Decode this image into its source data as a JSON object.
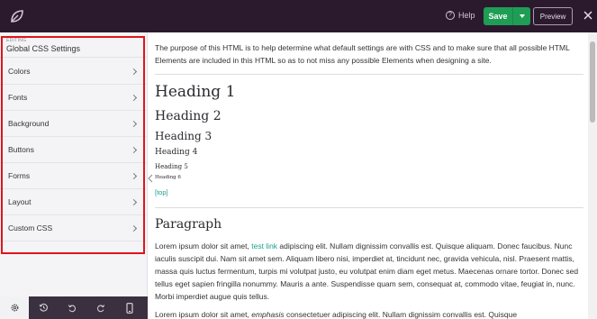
{
  "topbar": {
    "help_label": "Help",
    "save_label": "Save",
    "preview_label": "Preview"
  },
  "sidebar": {
    "editing_tag": "EDITING",
    "title": "Global CSS Settings",
    "items": [
      {
        "label": "Colors"
      },
      {
        "label": "Fonts"
      },
      {
        "label": "Background"
      },
      {
        "label": "Buttons"
      },
      {
        "label": "Forms"
      },
      {
        "label": "Layout"
      },
      {
        "label": "Custom CSS"
      }
    ]
  },
  "content": {
    "intro": "The purpose of this HTML is to help determine what default settings are with CSS and to make sure that all possible HTML Elements are included in this HTML so as to not miss any possible Elements when designing a site.",
    "h1": "Heading 1",
    "h2": "Heading 2",
    "h3": "Heading 3",
    "h4": "Heading 4",
    "h5": "Heading 5",
    "h6": "Heading 6",
    "top_link": "[top]",
    "paragraph_heading": "Paragraph",
    "p1_before": "Lorem ipsum dolor sit amet, ",
    "p1_link": "test link",
    "p1_after": " adipiscing elit. Nullam dignissim convallis est. Quisque aliquam. Donec faucibus. Nunc iaculis suscipit dui. Nam sit amet sem. Aliquam libero nisi, imperdiet at, tincidunt nec, gravida vehicula, nisl. Praesent mattis, massa quis luctus fermentum, turpis mi volutpat justo, eu volutpat enim diam eget metus. Maecenas ornare tortor. Donec sed tellus eget sapien fringilla nonummy. Mauris a ante. Suspendisse quam sem, consequat at, commodo vitae, feugiat in, nunc. Morbi imperdiet augue quis tellus.",
    "p2_before": "Lorem ipsum dolor sit amet, ",
    "p2_em": "emphasis",
    "p2_after": " consectetuer adipiscing elit. Nullam dignissim convallis est. Quisque"
  },
  "colors": {
    "topbar_bg": "#2b1a2e",
    "save_green": "#1f9d55",
    "highlight_red": "#e0141c",
    "link_teal": "#1aa18f"
  }
}
